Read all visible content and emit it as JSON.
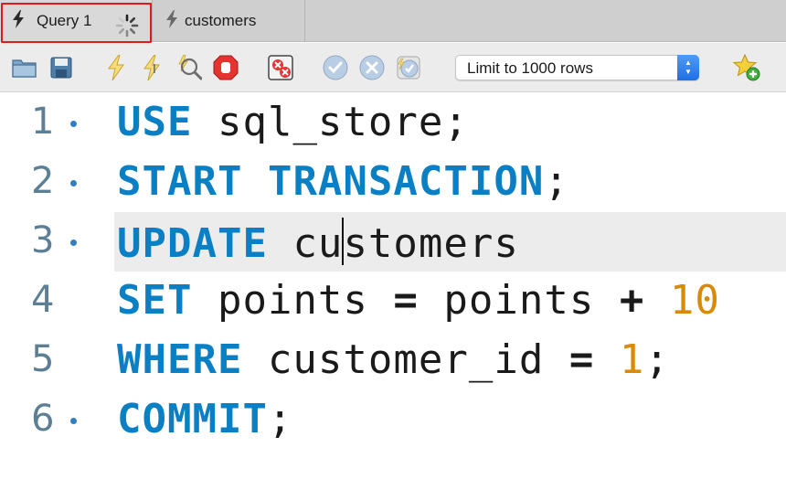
{
  "tabs": [
    {
      "label": "Query 1",
      "active": true,
      "loading": true
    },
    {
      "label": "customers",
      "active": false
    }
  ],
  "toolbar": {
    "limit_select_value": "Limit to 1000 rows",
    "icons": [
      "open-folder-icon",
      "save-icon",
      "execute-icon",
      "execute-current-icon",
      "explain-icon",
      "stop-icon",
      "toggle-error-icon",
      "commit-icon",
      "rollback-icon",
      "autocommit-icon",
      "add-snippet-icon"
    ]
  },
  "editor": {
    "lines": [
      {
        "number": "1",
        "dot": true,
        "tokens": [
          {
            "t": "USE",
            "c": "kw"
          },
          {
            "t": " sql_store;",
            "c": ""
          }
        ]
      },
      {
        "number": "2",
        "dot": true,
        "tokens": [
          {
            "t": "START",
            "c": "kw"
          },
          {
            "t": " ",
            "c": ""
          },
          {
            "t": "TRANSACTION",
            "c": "kw"
          },
          {
            "t": ";",
            "c": ""
          }
        ]
      },
      {
        "number": "3",
        "dot": true,
        "current": true,
        "tokens": [
          {
            "t": "UPDATE",
            "c": "kw"
          },
          {
            "t": " cu",
            "c": ""
          },
          {
            "t": "",
            "c": "caret"
          },
          {
            "t": "stomers",
            "c": ""
          }
        ]
      },
      {
        "number": "4",
        "dot": false,
        "tokens": [
          {
            "t": "SET",
            "c": "kw"
          },
          {
            "t": " points ",
            "c": ""
          },
          {
            "t": "=",
            "c": "op"
          },
          {
            "t": " points ",
            "c": ""
          },
          {
            "t": "+",
            "c": "op"
          },
          {
            "t": " ",
            "c": ""
          },
          {
            "t": "10",
            "c": "num"
          }
        ]
      },
      {
        "number": "5",
        "dot": false,
        "tokens": [
          {
            "t": "WHERE",
            "c": "kw"
          },
          {
            "t": " customer_id ",
            "c": ""
          },
          {
            "t": "=",
            "c": "op"
          },
          {
            "t": " ",
            "c": ""
          },
          {
            "t": "1",
            "c": "num"
          },
          {
            "t": ";",
            "c": ""
          }
        ]
      },
      {
        "number": "6",
        "dot": true,
        "tokens": [
          {
            "t": "COMMIT",
            "c": "kw"
          },
          {
            "t": ";",
            "c": ""
          }
        ]
      }
    ]
  },
  "colors": {
    "keyword": "#0a7fc4",
    "number": "#d98a06",
    "gutter": "#5c7f95",
    "highlight_border": "#e01b1b"
  }
}
